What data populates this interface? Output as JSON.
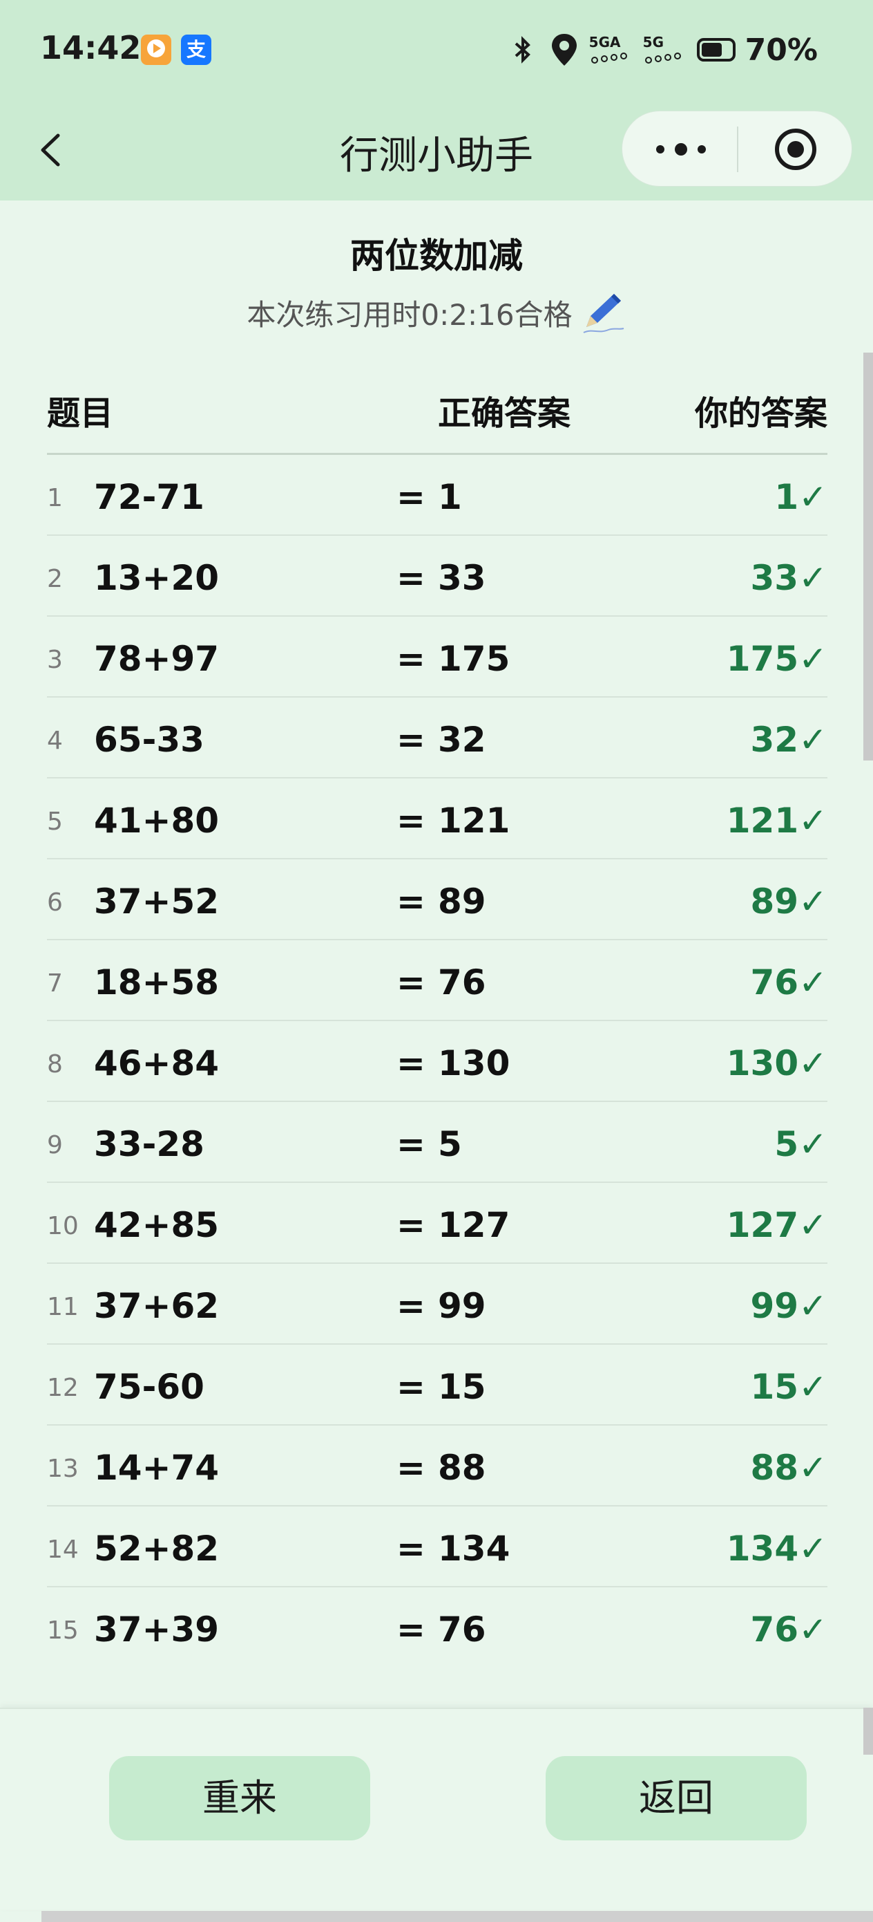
{
  "status_bar": {
    "time": "14:42",
    "app_badge_video": "",
    "app_badge_alipay": "支",
    "network_1": "5GA",
    "network_2": "5G",
    "battery_percent": "70%",
    "battery_level": 0.7
  },
  "nav": {
    "title": "行测小助手"
  },
  "quiz": {
    "title": "两位数加减",
    "subtitle": "本次练习用时0:2:16合格"
  },
  "table": {
    "headers": {
      "question": "题目",
      "correct": "正确答案",
      "yours": "你的答案"
    },
    "equals": "=",
    "rows": [
      {
        "index": "1",
        "question": "72-71",
        "correct": "1",
        "yours": "1✓"
      },
      {
        "index": "2",
        "question": "13+20",
        "correct": "33",
        "yours": "33✓"
      },
      {
        "index": "3",
        "question": "78+97",
        "correct": "175",
        "yours": "175✓"
      },
      {
        "index": "4",
        "question": "65-33",
        "correct": "32",
        "yours": "32✓"
      },
      {
        "index": "5",
        "question": "41+80",
        "correct": "121",
        "yours": "121✓"
      },
      {
        "index": "6",
        "question": "37+52",
        "correct": "89",
        "yours": "89✓"
      },
      {
        "index": "7",
        "question": "18+58",
        "correct": "76",
        "yours": "76✓"
      },
      {
        "index": "8",
        "question": "46+84",
        "correct": "130",
        "yours": "130✓"
      },
      {
        "index": "9",
        "question": "33-28",
        "correct": "5",
        "yours": "5✓"
      },
      {
        "index": "10",
        "question": "42+85",
        "correct": "127",
        "yours": "127✓"
      },
      {
        "index": "11",
        "question": "37+62",
        "correct": "99",
        "yours": "99✓"
      },
      {
        "index": "12",
        "question": "75-60",
        "correct": "15",
        "yours": "15✓"
      },
      {
        "index": "13",
        "question": "14+74",
        "correct": "88",
        "yours": "88✓"
      },
      {
        "index": "14",
        "question": "52+82",
        "correct": "134",
        "yours": "134✓"
      },
      {
        "index": "15",
        "question": "37+39",
        "correct": "76",
        "yours": "76✓"
      }
    ]
  },
  "buttons": {
    "restart": "重来",
    "back": "返回"
  },
  "colors": {
    "header_bg": "#cbebd2",
    "page_bg": "#e9f6ec",
    "button_bg": "#c6ebcf",
    "correct_green": "#1e7a45"
  },
  "icons": {
    "back": "chevron-left-icon",
    "more": "more-dots-icon",
    "close": "target-circle-icon",
    "pen": "pen-icon"
  }
}
